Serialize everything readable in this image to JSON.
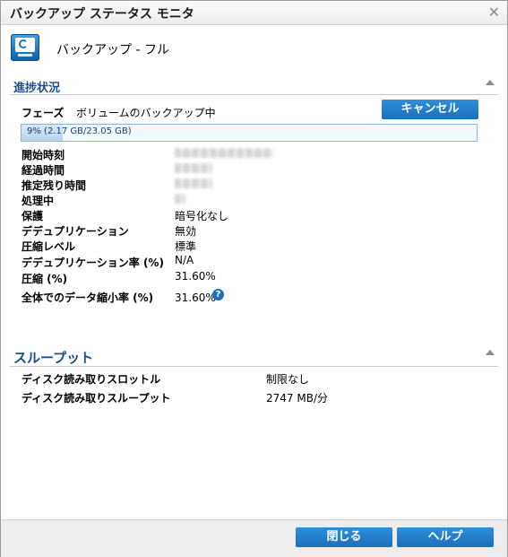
{
  "window": {
    "title": "バックアップ ステータス モニタ",
    "close_glyph": "✕"
  },
  "header": {
    "title": "バックアップ - フル",
    "icon": "backup-monitor-icon"
  },
  "progress_section": {
    "title": "進捗状況",
    "phase_label": "フェーズ",
    "phase_value": "ボリュームのバックアップ中",
    "cancel_label": "キャンセル",
    "progress_text": "9% (2.17 GB/23.05 GB)",
    "progress_fraction": 0.09,
    "rows": [
      {
        "label": "開始時刻",
        "value": ""
      },
      {
        "label": "経過時間",
        "value": ""
      },
      {
        "label": "推定残り時間",
        "value": ""
      },
      {
        "label": "処理中",
        "value": ""
      },
      {
        "label": "保護",
        "value": "暗号化なし"
      },
      {
        "label": "デデュプリケーション",
        "value": "無効"
      },
      {
        "label": "圧縮レベル",
        "value": "標準"
      },
      {
        "label": "デデュプリケーション率 (%)",
        "value": "N/A"
      },
      {
        "label": "圧縮 (%)",
        "value": "31.60%"
      },
      {
        "label": "全体でのデータ縮小率 (%)",
        "value": "31.60%"
      }
    ],
    "help_glyph": "?"
  },
  "throughput_section": {
    "title": "スループット",
    "rows": [
      {
        "label": "ディスク読み取りスロットル",
        "value": "制限なし"
      },
      {
        "label": "ディスク読み取りスループット",
        "value": "2747 MB/分"
      }
    ]
  },
  "footer": {
    "close_label": "閉じる",
    "help_label": "ヘルプ"
  },
  "colors": {
    "accent": "#1b6fbd",
    "section_title": "#1b4f8c"
  }
}
